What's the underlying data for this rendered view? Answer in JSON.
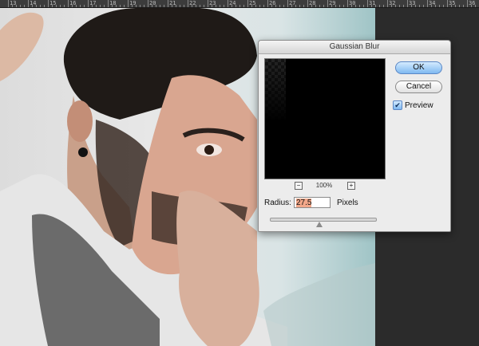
{
  "ruler": {
    "numbers": [
      "13",
      "14",
      "15",
      "16",
      "17",
      "18",
      "19",
      "20",
      "21",
      "22",
      "23",
      "24",
      "25",
      "26",
      "27",
      "28",
      "29",
      "30",
      "31",
      "32",
      "33",
      "34",
      "35",
      "36"
    ]
  },
  "dialog": {
    "title": "Gaussian Blur",
    "ok_label": "OK",
    "cancel_label": "Cancel",
    "preview_label": "Preview",
    "preview_checked": true,
    "zoom_level": "100%",
    "zoom_out_symbol": "−",
    "zoom_in_symbol": "+",
    "radius_label": "Radius:",
    "radius_value": "27.5",
    "radius_unit": "Pixels",
    "radius_slider_fraction": 0.47
  },
  "colors": {
    "accent": "#7fb9f1",
    "selection": "#f3a88a",
    "canvas_dark": "#2b2b2b"
  },
  "icons": {
    "checkbox": "checkmark-icon",
    "zoom_out": "zoom-out-icon",
    "zoom_in": "zoom-in-icon"
  }
}
